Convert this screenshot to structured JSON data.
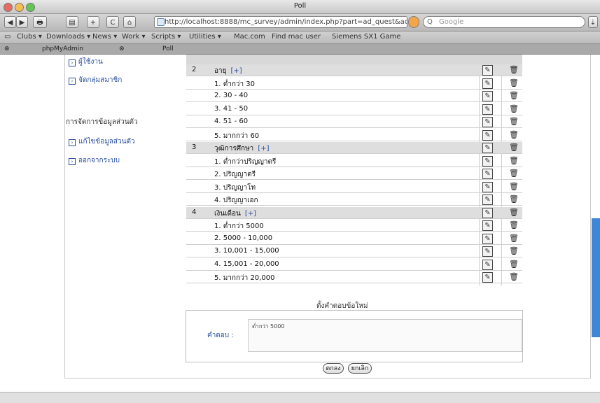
{
  "window": {
    "title": "Poll"
  },
  "toolbar": {
    "url": "http://localhost:8888/mc_survey/admin/index.php?part=ad_quest&action=",
    "search_placeholder": "Google",
    "back_glyph": "◀",
    "forward_glyph": "▶",
    "print_glyph": "🖶",
    "reload_glyph": "C",
    "home_glyph": "⌂",
    "add_glyph": "+"
  },
  "bookmarks": [
    "Clubs ▾",
    "Downloads ▾",
    "News ▾",
    "Work ▾",
    "Scripts ▾",
    "Utilities ▾",
    "Mac.com",
    "Find mac user",
    "Siemens SX1 Game"
  ],
  "tabs": [
    "phpMyAdmin",
    "Poll"
  ],
  "sidebar": {
    "partial_top": "ผู้ใช้งาน",
    "manage_members": "จัดกลุ่มสมาชิก",
    "personal_heading": "การจัดการข้อมูลส่วนตัว",
    "edit_personal": "แก้ไขข้อมูลส่วนตัว",
    "logout": "ออกจากระบบ"
  },
  "questions": [
    {
      "type": "q",
      "num": "2",
      "text": "อายุ",
      "add": "[+]"
    },
    {
      "type": "a",
      "text": "1. ต่ำกว่า 30"
    },
    {
      "type": "a",
      "text": "2. 30 - 40"
    },
    {
      "type": "a",
      "text": "3. 41 - 50"
    },
    {
      "type": "a",
      "text": "4. 51 - 60"
    },
    {
      "type": "a",
      "text": "5. มากกว่า 60"
    },
    {
      "type": "q",
      "num": "3",
      "text": "วุฒิการศึกษา",
      "add": "[+]"
    },
    {
      "type": "a",
      "text": "1. ต่ำกว่าปริญญาตรี"
    },
    {
      "type": "a",
      "text": "2. ปริญญาตรี"
    },
    {
      "type": "a",
      "text": "3. ปริญญาโท"
    },
    {
      "type": "a",
      "text": "4. ปริญญาเอก"
    },
    {
      "type": "q",
      "num": "4",
      "text": "เงินเดือน",
      "add": "[+]"
    },
    {
      "type": "a",
      "text": "1. ต่ำกว่า 5000"
    },
    {
      "type": "a",
      "text": "2. 5000 - 10,000"
    },
    {
      "type": "a",
      "text": "3. 10,001 - 15,000"
    },
    {
      "type": "a",
      "text": "4. 15,001 - 20,000"
    },
    {
      "type": "a",
      "text": "5. มากกว่า 20,000"
    }
  ],
  "form": {
    "title": "ตั้งคำตอบข้อใหม่",
    "label": "คำตอบ :",
    "input_value": "ต่ำกว่า 5000",
    "submit": "ตกลง",
    "cancel": "ยกเลิก"
  },
  "icons": {
    "edit": "edit-icon",
    "delete": "trash-icon"
  }
}
